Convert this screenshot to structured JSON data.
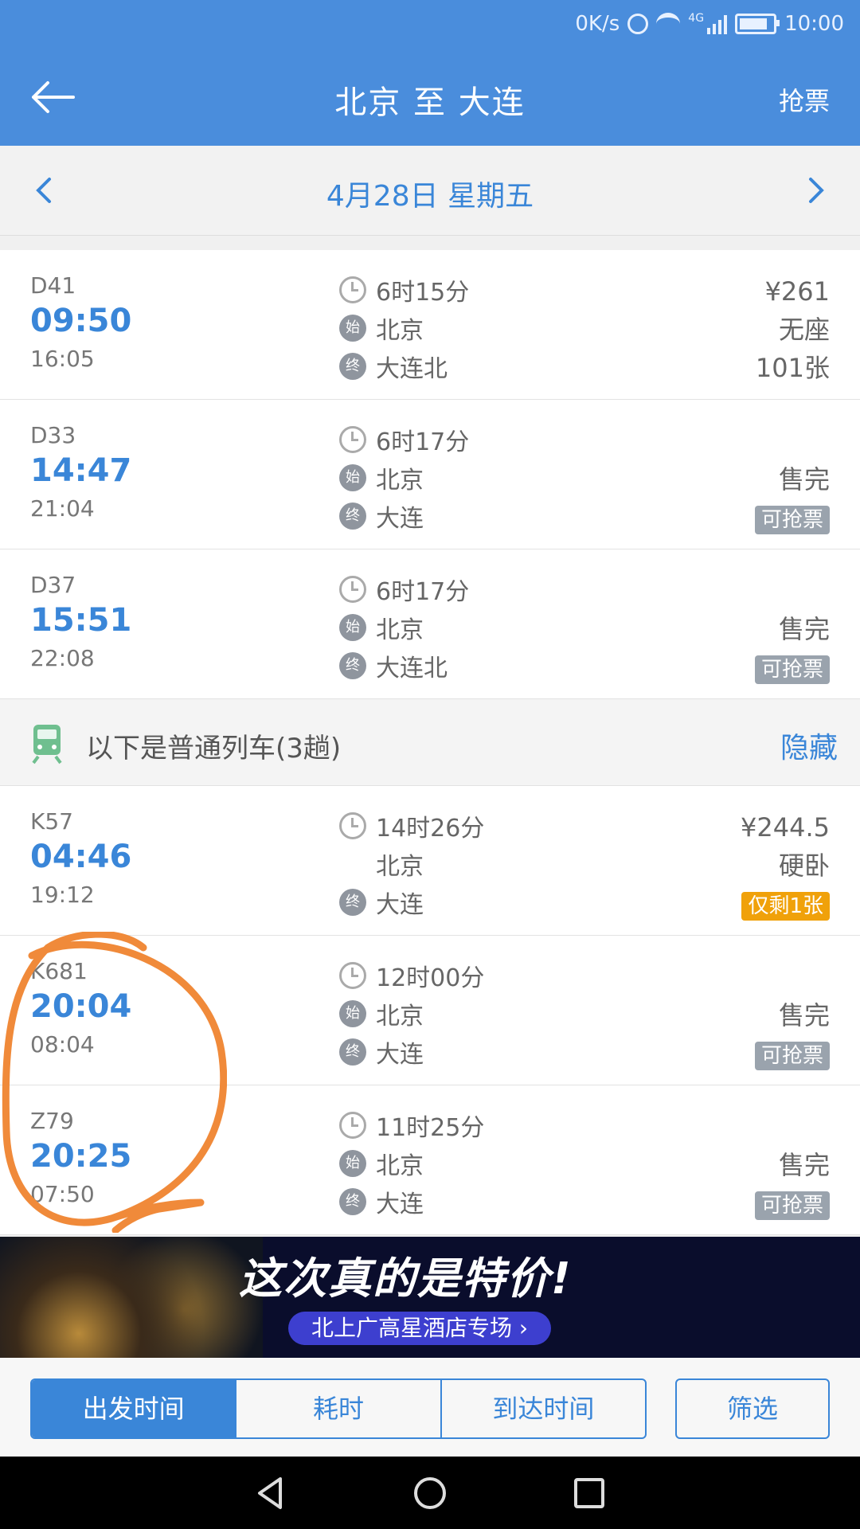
{
  "status_bar": {
    "net_speed": "0K/s",
    "time": "10:00",
    "network": "4G"
  },
  "header": {
    "title": "北京 至 大连",
    "action": "抢票"
  },
  "date_bar": {
    "date": "4月28日  星期五"
  },
  "trains_top": [
    {
      "number": "D41",
      "depart": "09:50",
      "arrive": "16:05",
      "duration": "6时15分",
      "from": "北京",
      "to": "大连北",
      "price": "¥261",
      "seat": "无座",
      "count": "101张"
    },
    {
      "number": "D33",
      "depart": "14:47",
      "arrive": "21:04",
      "duration": "6时17分",
      "from": "北京",
      "to": "大连",
      "seat": "售完",
      "tag": "可抢票"
    },
    {
      "number": "D37",
      "depart": "15:51",
      "arrive": "22:08",
      "duration": "6时17分",
      "from": "北京",
      "to": "大连北",
      "seat": "售完",
      "tag": "可抢票"
    }
  ],
  "section": {
    "label": "以下是普通列车(3趟)",
    "hide": "隐藏"
  },
  "trains_bottom": [
    {
      "number": "K57",
      "depart": "04:46",
      "arrive": "19:12",
      "duration": "14时26分",
      "from": "北京",
      "to": "大连",
      "price": "¥244.5",
      "seat": "硬卧",
      "tag": "仅剩1张"
    },
    {
      "number": "K681",
      "depart": "20:04",
      "arrive": "08:04",
      "duration": "12时00分",
      "from": "北京",
      "to": "大连",
      "seat": "售完",
      "tag": "可抢票"
    },
    {
      "number": "Z79",
      "depart": "20:25",
      "arrive": "07:50",
      "duration": "11时25分",
      "from": "北京",
      "to": "大连",
      "seat": "售完",
      "tag": "可抢票"
    }
  ],
  "badges": {
    "start": "始",
    "end": "终"
  },
  "banner": {
    "headline": "这次真的是特价!",
    "sub": "北上广高星酒店专场 ›"
  },
  "sort_tabs": [
    "出发时间",
    "耗时",
    "到达时间"
  ],
  "filter": "筛选",
  "colors": {
    "brand": "#4a8ddc",
    "accent": "#3a86d8",
    "annotation": "#f08a3a"
  }
}
